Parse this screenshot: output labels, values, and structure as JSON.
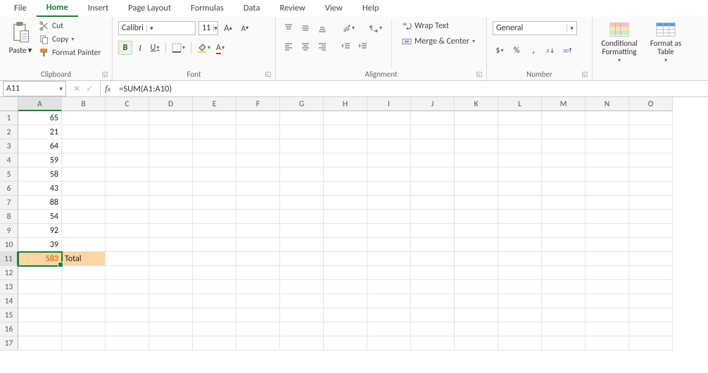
{
  "tabs": [
    "File",
    "Home",
    "Insert",
    "Page Layout",
    "Formulas",
    "Data",
    "Review",
    "View",
    "Help"
  ],
  "active_tab": "Home",
  "clipboard": {
    "paste": "Paste",
    "cut": "Cut",
    "copy": "Copy",
    "format_painter": "Format Painter",
    "group_label": "Clipboard"
  },
  "font": {
    "name": "Calibri",
    "size": "11",
    "group_label": "Font"
  },
  "alignment": {
    "wrap_text": "Wrap Text",
    "merge_center": "Merge & Center",
    "group_label": "Alignment"
  },
  "number": {
    "format": "General",
    "group_label": "Number"
  },
  "styles": {
    "conditional_formatting": "Conditional\nFormatting",
    "format_as_table": "Format as\nTable"
  },
  "name_box": "A11",
  "formula": "=SUM(A1:A10)",
  "columns": [
    "A",
    "B",
    "C",
    "D",
    "E",
    "F",
    "G",
    "H",
    "I",
    "J",
    "K",
    "L",
    "M",
    "N",
    "O"
  ],
  "selected_col": "A",
  "selected_row": 11,
  "rows": [
    1,
    2,
    3,
    4,
    5,
    6,
    7,
    8,
    9,
    10,
    11,
    12,
    13,
    14,
    15,
    16,
    17
  ],
  "cells": {
    "A1": "65",
    "A2": "21",
    "A3": "64",
    "A4": "59",
    "A5": "58",
    "A6": "43",
    "A7": "88",
    "A8": "54",
    "A9": "92",
    "A10": "39",
    "A11": "583",
    "B11": "Total"
  }
}
